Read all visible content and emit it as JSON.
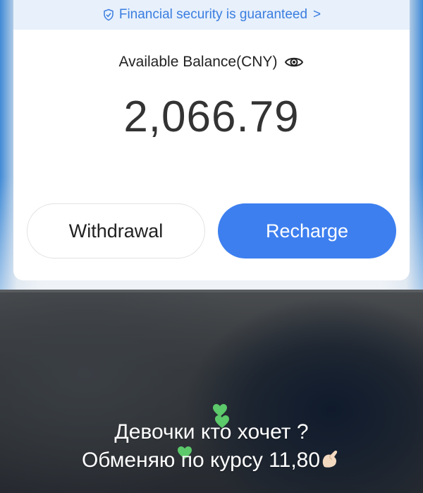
{
  "banner": {
    "text": "Financial security is guaranteed",
    "chevron": ">",
    "icon": "shield-check-icon",
    "color": "#3a7de0"
  },
  "balance": {
    "label": "Available Balance(CNY)",
    "amount": "2,066.79",
    "toggle_icon": "eye-icon"
  },
  "buttons": {
    "withdrawal": "Withdrawal",
    "recharge": "Recharge",
    "recharge_color": "#3d7fef"
  },
  "caption": {
    "line1": "Девочки кто хочет ?",
    "line2": "Обменяю по курсу 11,80",
    "emojis": [
      "green-heart-icon",
      "green-heart-icon",
      "green-heart-icon",
      "pinching-hand-icon"
    ]
  }
}
